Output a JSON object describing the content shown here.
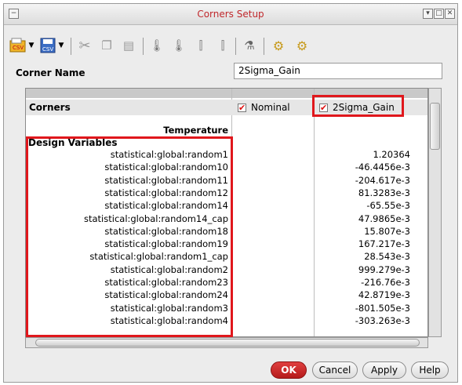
{
  "window": {
    "title": "Corners Setup"
  },
  "corner_name": {
    "label": "Corner Name",
    "value": "2Sigma_Gain"
  },
  "grid": {
    "corners_label": "Corners",
    "col_nominal": "Nominal",
    "col_2sigma": "2Sigma_Gain",
    "temperature_label": "Temperature",
    "section_design_variables": "Design Variables",
    "rows": [
      {
        "name": "statistical:global:random1",
        "value": "1.20364"
      },
      {
        "name": "statistical:global:random10",
        "value": "-46.4456e-3"
      },
      {
        "name": "statistical:global:random11",
        "value": "-204.617e-3"
      },
      {
        "name": "statistical:global:random12",
        "value": "81.3283e-3"
      },
      {
        "name": "statistical:global:random14",
        "value": "-65.55e-3"
      },
      {
        "name": "statistical:global:random14_cap",
        "value": "47.9865e-3"
      },
      {
        "name": "statistical:global:random18",
        "value": "15.807e-3"
      },
      {
        "name": "statistical:global:random19",
        "value": "167.217e-3"
      },
      {
        "name": "statistical:global:random1_cap",
        "value": "28.543e-3"
      },
      {
        "name": "statistical:global:random2",
        "value": "999.279e-3"
      },
      {
        "name": "statistical:global:random23",
        "value": "-216.76e-3"
      },
      {
        "name": "statistical:global:random24",
        "value": "42.8719e-3"
      },
      {
        "name": "statistical:global:random3",
        "value": "-801.505e-3"
      },
      {
        "name": "statistical:global:random4",
        "value": "-303.263e-3"
      }
    ]
  },
  "buttons": {
    "ok": "OK",
    "cancel": "Cancel",
    "apply": "Apply",
    "help": "Help"
  }
}
